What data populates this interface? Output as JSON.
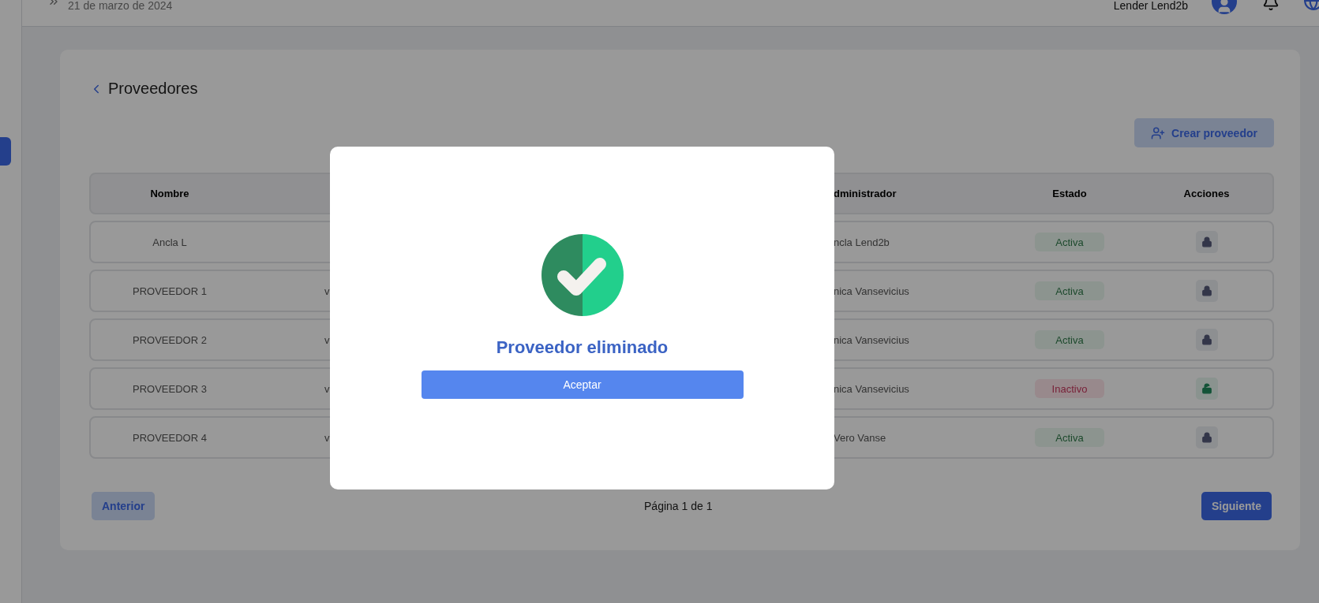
{
  "header": {
    "date": "21 de marzo de 2024",
    "user": "Lender Lend2b"
  },
  "page": {
    "title": "Proveedores",
    "create_button": "Crear proveedor"
  },
  "table": {
    "columns": [
      "Nombre",
      "dministrador",
      "Estado",
      "Acciones"
    ],
    "rows": [
      {
        "nombre": "Ancla L",
        "column_2": "",
        "administrador": "ncla Lend2b",
        "estado": "Activa",
        "active": true,
        "locked": true
      },
      {
        "nombre": "PROVEEDOR 1",
        "column_2": "v",
        "administrador": "nica Vansevicius",
        "estado": "Activa",
        "active": true,
        "locked": true
      },
      {
        "nombre": "PROVEEDOR 2",
        "column_2": "v",
        "administrador": "nica Vansevicius",
        "estado": "Activa",
        "active": true,
        "locked": true
      },
      {
        "nombre": "PROVEEDOR 3",
        "column_2": "v",
        "administrador": "nica Vansevicius",
        "estado": "Inactivo",
        "active": false,
        "locked": false
      },
      {
        "nombre": "PROVEEDOR 4",
        "column_2": "v",
        "administrador": "Vero Vanse",
        "estado": "Activa",
        "active": true,
        "locked": true
      }
    ]
  },
  "pagination": {
    "previous": "Anterior",
    "info": "Página 1 de 1",
    "next": "Siguiente"
  },
  "modal": {
    "title": "Proveedor eliminado",
    "button": "Aceptar"
  }
}
